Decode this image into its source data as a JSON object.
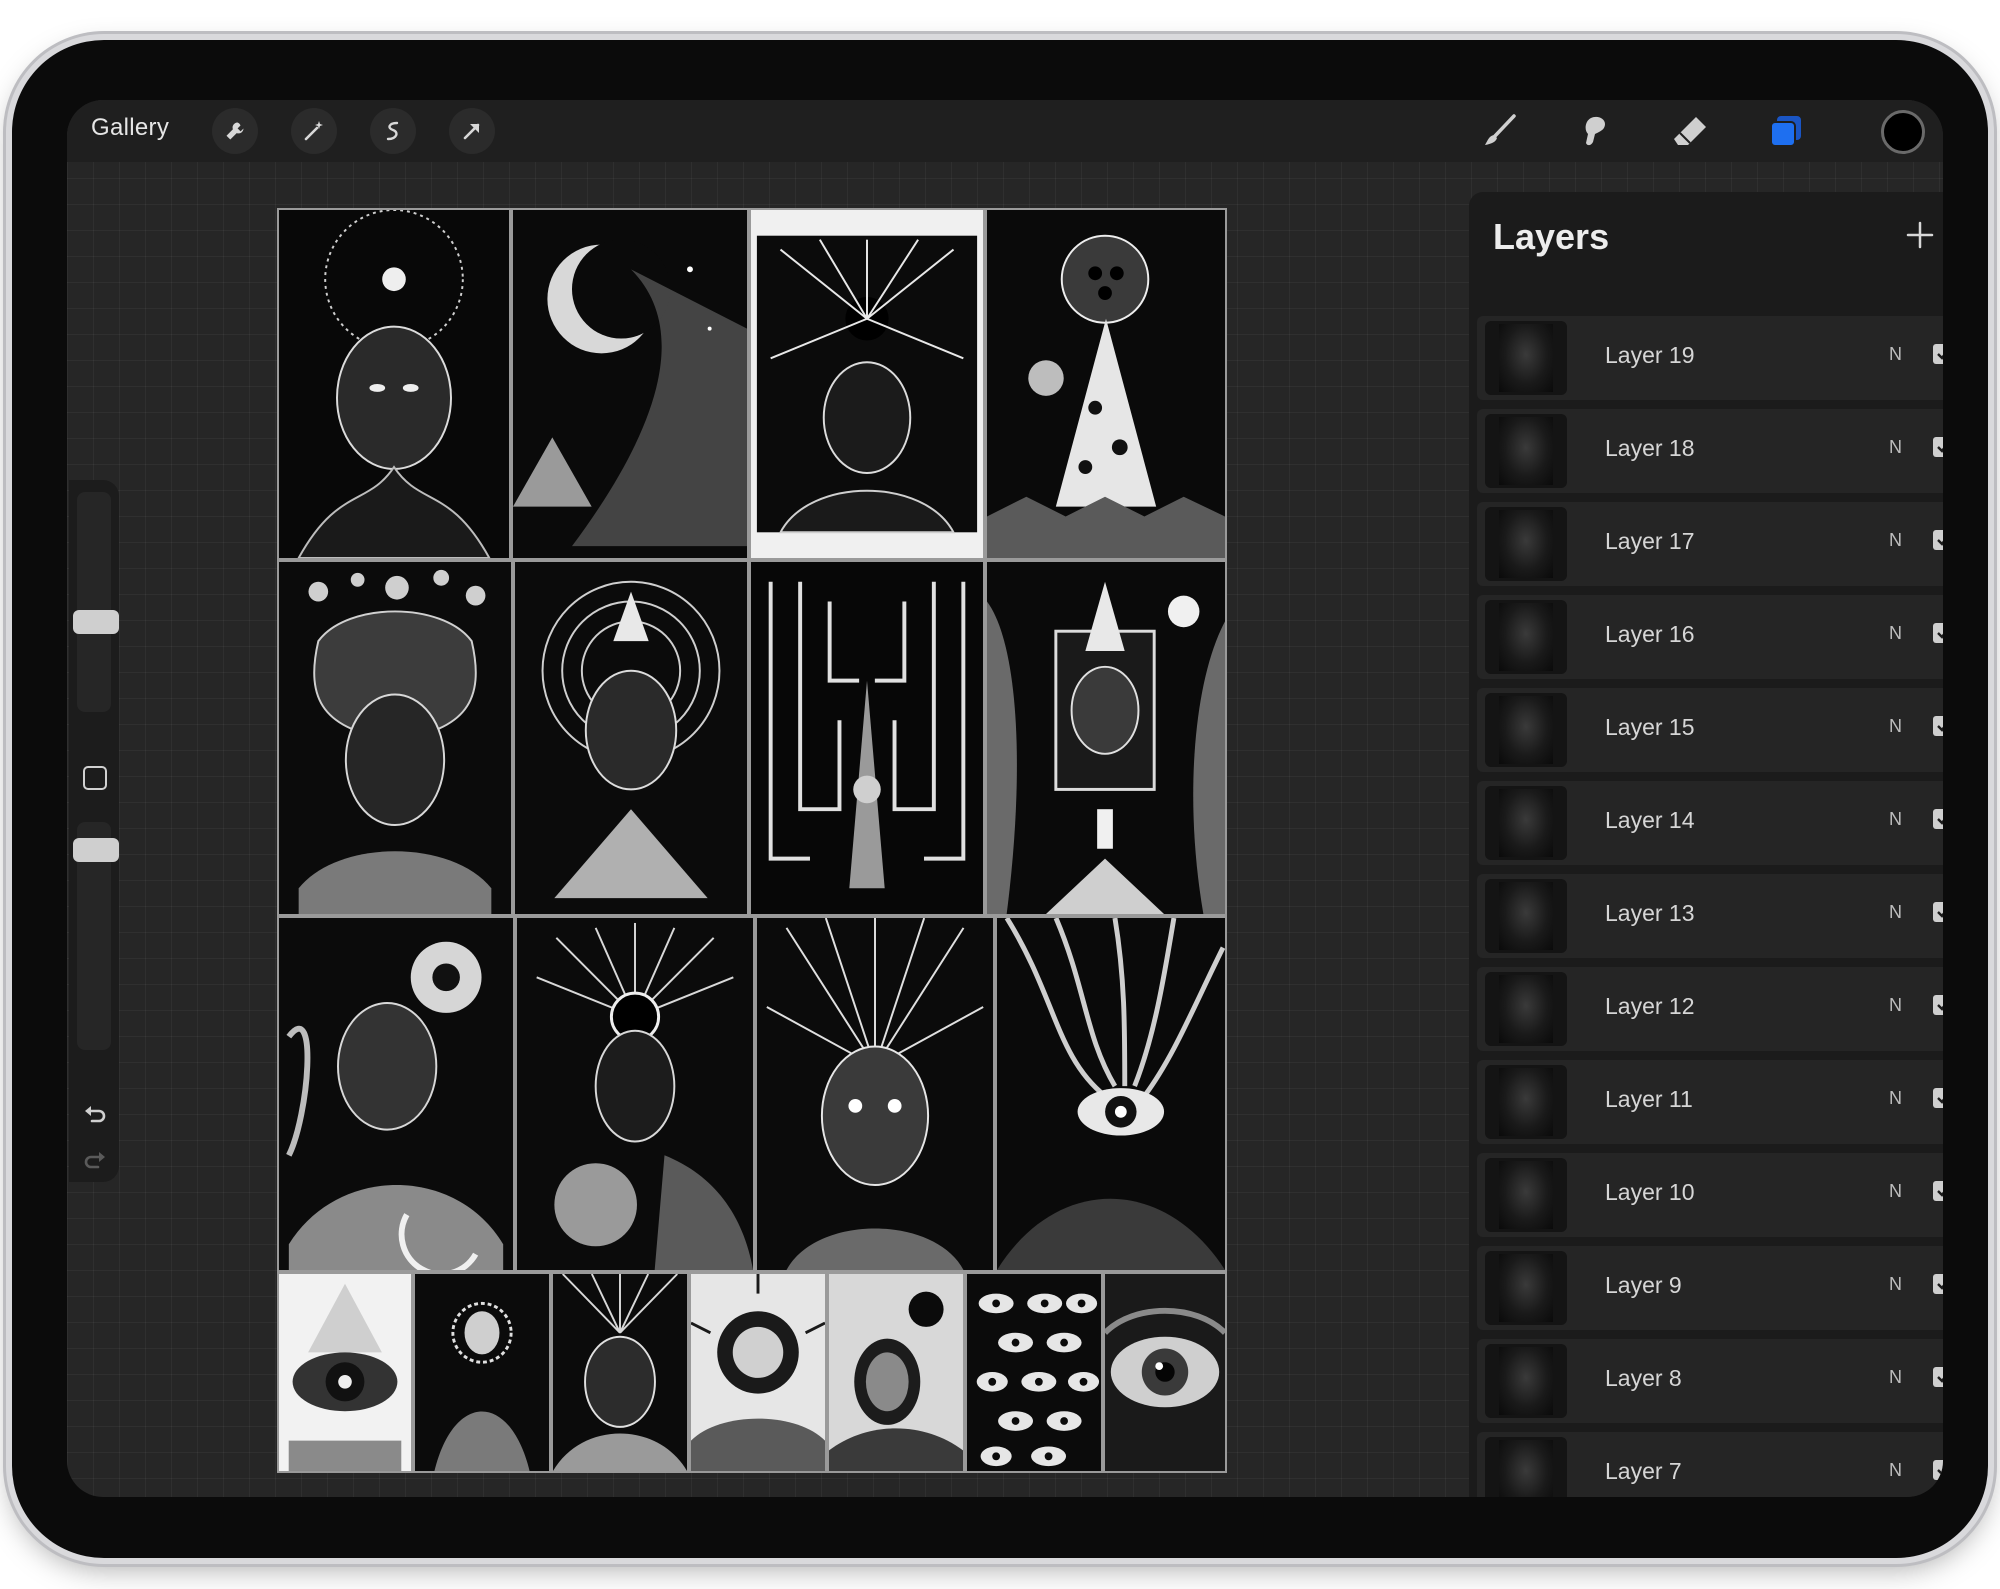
{
  "toolbar": {
    "gallery_label": "Gallery",
    "left_tools": [
      "wrench-icon",
      "magic-wand-icon",
      "selection-icon",
      "transform-arrow-icon"
    ],
    "right_tools": [
      "brush-icon",
      "smudge-icon",
      "eraser-icon",
      "layers-icon"
    ],
    "accent_color": "#1e6ff0"
  },
  "layers_panel": {
    "title": "Layers",
    "add_symbol": "+",
    "layers": [
      {
        "name": "Layer 19",
        "blend": "N",
        "visible": true
      },
      {
        "name": "Layer 18",
        "blend": "N",
        "visible": true
      },
      {
        "name": "Layer 17",
        "blend": "N",
        "visible": true
      },
      {
        "name": "Layer 16",
        "blend": "N",
        "visible": true
      },
      {
        "name": "Layer 15",
        "blend": "N",
        "visible": true
      },
      {
        "name": "Layer 14",
        "blend": "N",
        "visible": true
      },
      {
        "name": "Layer 13",
        "blend": "N",
        "visible": true
      },
      {
        "name": "Layer 12",
        "blend": "N",
        "visible": true
      },
      {
        "name": "Layer 11",
        "blend": "N",
        "visible": true
      },
      {
        "name": "Layer 10",
        "blend": "N",
        "visible": true
      },
      {
        "name": "Layer 9",
        "blend": "N",
        "visible": true
      },
      {
        "name": "Layer 8",
        "blend": "N",
        "visible": true
      },
      {
        "name": "Layer 7",
        "blend": "N",
        "visible": true
      }
    ]
  }
}
